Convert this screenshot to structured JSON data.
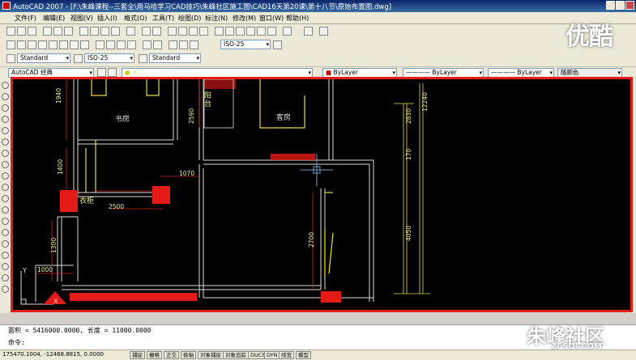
{
  "window": {
    "title": "AutoCAD 2007 - [F:\\朱峰课程--三套全\\用马哈学习CAD技巧\\朱峰社区施工图\\CAD16天第20课\\第十八节\\原始布置图.dwg]"
  },
  "menu": {
    "items": [
      "文件(F)",
      "编辑(E)",
      "视图(V)",
      "插入(I)",
      "格式(O)",
      "工具(T)",
      "绘图(D)",
      "标注(N)",
      "修改(M)",
      "窗口(W)",
      "帮助(H)"
    ]
  },
  "toolbar": {
    "dim_style_combo": "ISO-25",
    "text_style": "Standard",
    "dim_style": "ISO-25",
    "table_style": "Standard",
    "workspace": "AutoCAD 经典",
    "layer_color": "ByLayer",
    "linetype": "ByLayer",
    "lineweight": "ByLayer",
    "plot_style": "随颜色"
  },
  "watermark": {
    "top_right": "优酷",
    "bottom_right": "朱峰社区",
    "bottom_url": "ZFSDI.COM"
  },
  "drawing": {
    "rooms": [
      "书房",
      "客房",
      "衣柜",
      "阳台"
    ],
    "dimensions": [
      "1940",
      "2590",
      "1400",
      "1070",
      "2500",
      "1000",
      "1300",
      "2700",
      "4050",
      "2830",
      "170",
      "12240",
      "1000"
    ],
    "ucs_x": "X",
    "ucs_y": "Y"
  },
  "command": {
    "line1": "面积 = 5416000.0000,  长度 = 11000.0000",
    "line2": "命令:"
  },
  "status": {
    "coords": "175470.1004, -12468.8815, 0.0000",
    "toggles": [
      "捕捉",
      "栅格",
      "正交",
      "极轴",
      "对象捕捉",
      "对象追踪",
      "DUCS",
      "DYN",
      "线宽",
      "模型"
    ]
  }
}
